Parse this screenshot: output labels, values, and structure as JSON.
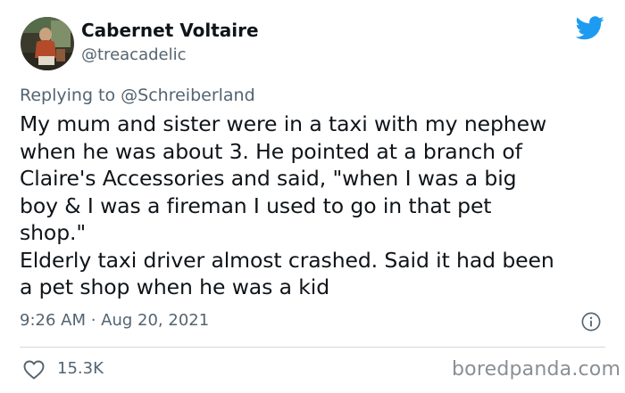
{
  "author": {
    "display_name": "Cabernet Voltaire",
    "handle": "@treacadelic"
  },
  "reply": {
    "text": "Replying to @Schreiberland"
  },
  "tweet": {
    "lines": [
      "My mum and sister were in a taxi with my nephew",
      "when he was about 3. He pointed at a branch of",
      "Claire's Accessories and said, \"when I was a big",
      "boy & I was a fireman I used to go in that pet",
      "shop.\"",
      "Elderly taxi driver almost crashed. Said it had been",
      "a pet shop when he was a kid"
    ],
    "timestamp": "9:26 AM · Aug 20, 2021"
  },
  "engagement": {
    "likes": "15.3K"
  },
  "watermark": "boredpanda.com",
  "icons": {
    "brand": "twitter-bird-icon",
    "info": "info-icon",
    "like": "heart-icon"
  },
  "colors": {
    "twitter_blue": "#1d9bf0",
    "text_primary": "#0f1419",
    "text_secondary": "#536471",
    "divider": "#cfd9de"
  }
}
